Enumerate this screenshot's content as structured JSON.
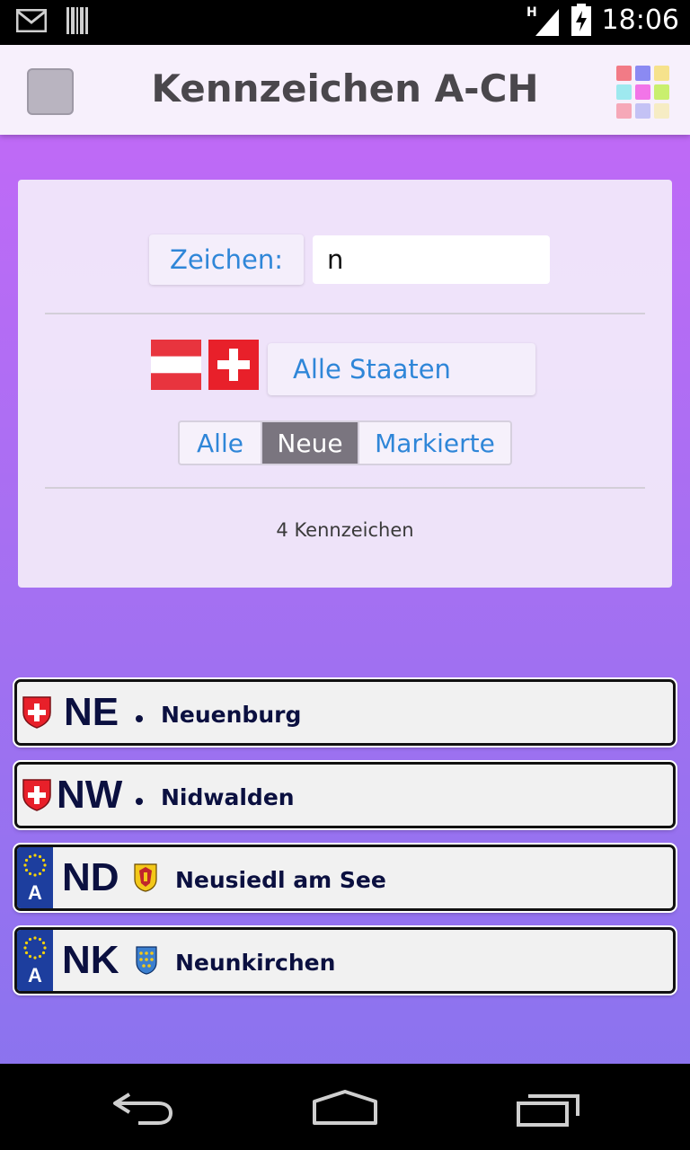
{
  "status_bar": {
    "time": "18:06",
    "network_label": "H",
    "icons": [
      "gmail-icon",
      "barcode-icon",
      "signal-icon",
      "battery-charging-icon"
    ]
  },
  "header": {
    "title": "Kennzeichen A-CH"
  },
  "filter": {
    "label": "Zeichen:",
    "input_value": "n",
    "states_button": "Alle Staaten",
    "segments": [
      "Alle",
      "Neue",
      "Markierte"
    ],
    "selected_segment": "Neue",
    "count_text": "4 Kennzeichen"
  },
  "plates": [
    {
      "country": "CH",
      "code": "NE",
      "name": "Neuenburg"
    },
    {
      "country": "CH",
      "code": "NW",
      "name": "Nidwalden"
    },
    {
      "country": "A",
      "code": "ND",
      "name": "Neusiedl am See",
      "band_letter": "A"
    },
    {
      "country": "A",
      "code": "NK",
      "name": "Neunkirchen",
      "band_letter": "A"
    }
  ],
  "colors": {
    "accent_blue": "#2f86d8",
    "plate_text": "#0b1040",
    "eu_blue": "#1d3e9e",
    "swiss_red": "#e8202a",
    "austria_red": "#e8343e"
  }
}
